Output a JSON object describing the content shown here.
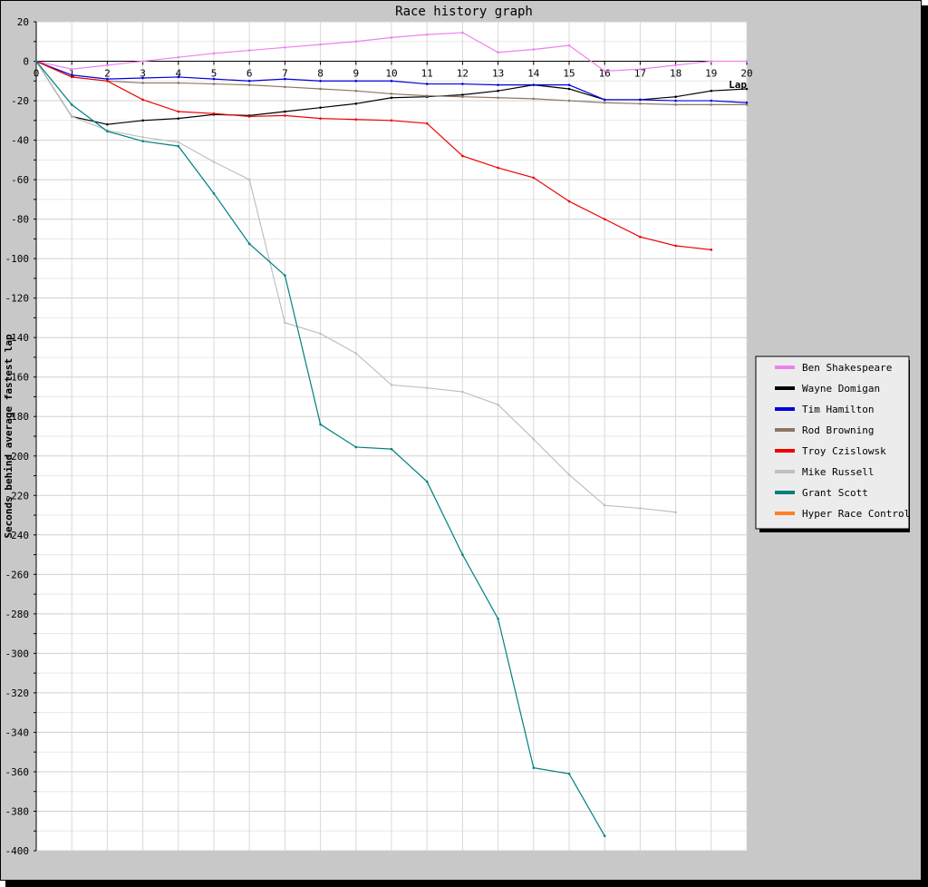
{
  "chart_data": {
    "type": "line",
    "title": "Race history graph",
    "xlabel": "Lap",
    "ylabel": "Seconds behind average fastest lap",
    "xlim": [
      0,
      20
    ],
    "ylim": [
      -400,
      20
    ],
    "x_ticks": [
      0,
      1,
      2,
      3,
      4,
      5,
      6,
      7,
      8,
      9,
      10,
      11,
      12,
      13,
      14,
      15,
      16,
      17,
      18,
      19,
      20
    ],
    "y_ticks": [
      20,
      0,
      -20,
      -40,
      -60,
      -80,
      -100,
      -120,
      -140,
      -160,
      -180,
      -200,
      -220,
      -240,
      -260,
      -280,
      -300,
      -320,
      -340,
      -360,
      -380,
      -400
    ],
    "grid": true,
    "legend_position": "right",
    "series": [
      {
        "name": "Ben Shakespeare",
        "color": "#ee82ee",
        "x": [
          0,
          1,
          2,
          3,
          4,
          5,
          6,
          7,
          8,
          9,
          10,
          11,
          12,
          13,
          14,
          15,
          16,
          17,
          18,
          19,
          20
        ],
        "values": [
          0,
          -4,
          -2,
          0,
          2,
          4,
          5.5,
          7,
          8.5,
          10,
          12,
          13.5,
          14.5,
          4.5,
          6,
          8,
          -5,
          -4,
          -2,
          0,
          0
        ]
      },
      {
        "name": "Wayne Domigan",
        "color": "#000000",
        "x": [
          0,
          1,
          2,
          3,
          4,
          5,
          6,
          7,
          8,
          9,
          10,
          11,
          12,
          13,
          14,
          15,
          16,
          17,
          18,
          19,
          20
        ],
        "values": [
          0,
          -28,
          -32,
          -30,
          -29,
          -27,
          -27.5,
          -25.5,
          -23.5,
          -21.5,
          -18.5,
          -18,
          -17,
          -15,
          -12,
          -14,
          -19.5,
          -19.5,
          -18,
          -15,
          -14
        ]
      },
      {
        "name": "Tim Hamilton",
        "color": "#0000dd",
        "x": [
          0,
          1,
          2,
          3,
          4,
          5,
          6,
          7,
          8,
          9,
          10,
          11,
          12,
          13,
          14,
          15,
          16,
          17,
          18,
          19,
          20
        ],
        "values": [
          0,
          -7,
          -9,
          -8.5,
          -8,
          -9,
          -10,
          -9,
          -10,
          -10,
          -10,
          -11.5,
          -11.5,
          -12,
          -12,
          -12,
          -19.5,
          -19.5,
          -20,
          -20,
          -21
        ]
      },
      {
        "name": "Rod Browning",
        "color": "#8b7765",
        "x": [
          0,
          1,
          2,
          3,
          4,
          5,
          6,
          7,
          8,
          9,
          10,
          11,
          12,
          13,
          14,
          15,
          16,
          17,
          18,
          19,
          20
        ],
        "values": [
          0,
          -8,
          -10,
          -11,
          -11,
          -11.5,
          -12,
          -13,
          -14,
          -15,
          -16.5,
          -17.5,
          -18,
          -18.5,
          -19,
          -20,
          -21,
          -21.5,
          -22,
          -22,
          -22
        ]
      },
      {
        "name": "Troy Czislowsk",
        "color": "#ee0000",
        "x": [
          0,
          1,
          2,
          3,
          4,
          5,
          6,
          7,
          8,
          9,
          10,
          11,
          12,
          13,
          14,
          15,
          16,
          17,
          18,
          19
        ],
        "values": [
          0,
          -8,
          -10,
          -19.5,
          -25.5,
          -26.5,
          -28,
          -27.5,
          -29,
          -29.5,
          -30,
          -31.5,
          -48,
          -54,
          -59,
          -71,
          -80,
          -89,
          -93.5,
          -95.5
        ]
      },
      {
        "name": "Mike Russell",
        "color": "#c0c0c0",
        "x": [
          0,
          1,
          2,
          3,
          4,
          5,
          6,
          7,
          8,
          9,
          10,
          11,
          12,
          13,
          14,
          15,
          16,
          17,
          18
        ],
        "values": [
          0,
          -28,
          -35,
          -38.5,
          -41,
          -51,
          -60,
          -132.5,
          -138,
          -148,
          -164,
          -165.5,
          -167.5,
          -174,
          -191.5,
          -209.5,
          -225,
          -226.5,
          -228.5
        ]
      },
      {
        "name": "Grant Scott",
        "color": "#008080",
        "x": [
          0,
          1,
          2,
          3,
          4,
          5,
          6,
          7,
          8,
          9,
          10,
          11,
          12,
          13,
          14,
          15,
          16
        ],
        "values": [
          0,
          -22,
          -35.5,
          -40.5,
          -43,
          -67,
          -92.5,
          -108.5,
          -184,
          -195.5,
          -196.5,
          -213,
          -250,
          -282.5,
          -358,
          -361,
          -392.5
        ]
      },
      {
        "name": "Hyper Race Control",
        "color": "#ff7f27",
        "x": [],
        "values": []
      }
    ]
  }
}
